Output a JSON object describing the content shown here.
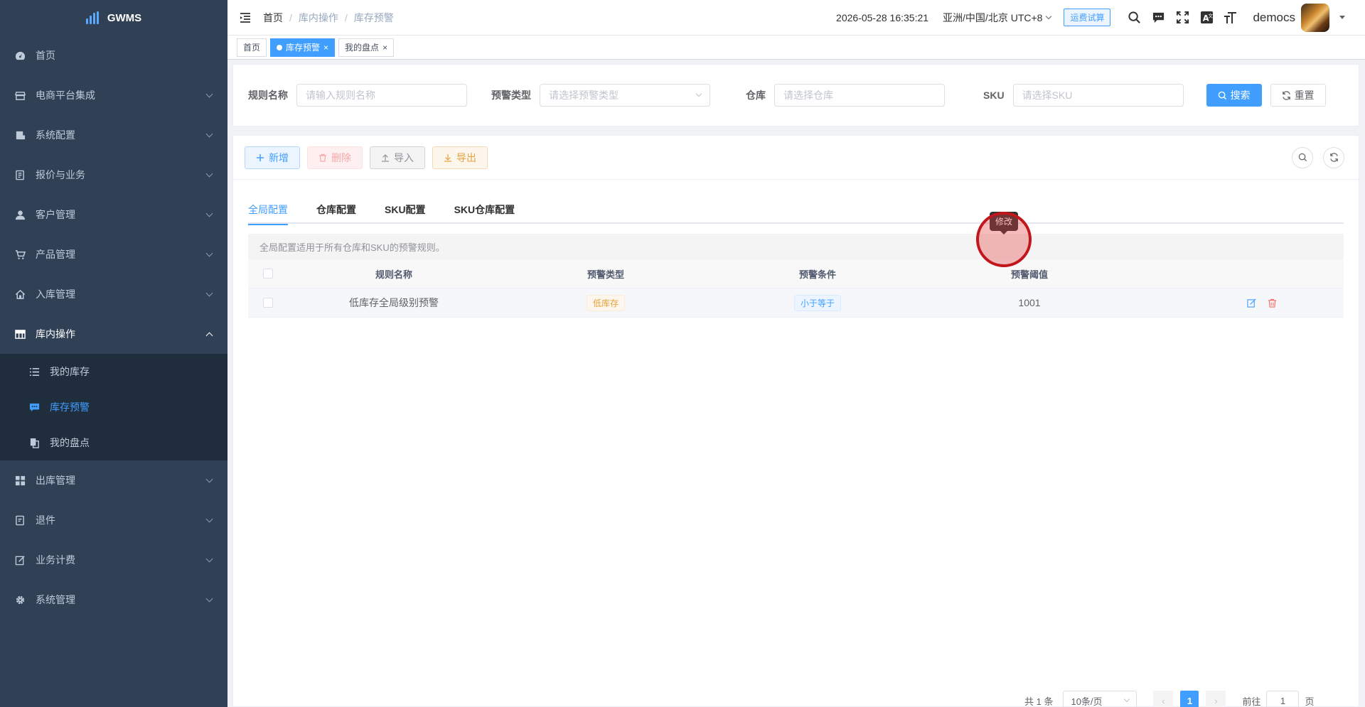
{
  "app": {
    "title": "GWMS"
  },
  "sidebar": {
    "items": [
      {
        "label": "首页",
        "icon": "dashboard-icon"
      },
      {
        "label": "电商平台集成",
        "icon": "store-icon"
      },
      {
        "label": "系统配置",
        "icon": "config-icon"
      },
      {
        "label": "报价与业务",
        "icon": "quote-icon"
      },
      {
        "label": "客户管理",
        "icon": "user-icon"
      },
      {
        "label": "产品管理",
        "icon": "cart-icon"
      },
      {
        "label": "入库管理",
        "icon": "home-icon"
      },
      {
        "label": "库内操作",
        "icon": "grid-icon"
      },
      {
        "label": "出库管理",
        "icon": "apps-icon"
      },
      {
        "label": "退件",
        "icon": "return-icon"
      },
      {
        "label": "业务计费",
        "icon": "edit-icon"
      },
      {
        "label": "系统管理",
        "icon": "gear-icon"
      }
    ],
    "submenu": [
      {
        "label": "我的库存",
        "icon": "list-icon"
      },
      {
        "label": "库存预警",
        "icon": "message-icon"
      },
      {
        "label": "我的盘点",
        "icon": "copy-icon"
      }
    ]
  },
  "header": {
    "breadcrumb": [
      "首页",
      "库内操作",
      "库存预警"
    ],
    "datetime": "2026-05-28 16:35:21",
    "timezone": "亚洲/中国/北京 UTC+8",
    "freight_badge": "运费试算",
    "username": "democs"
  },
  "tags": [
    {
      "label": "首页"
    },
    {
      "label": "库存预警"
    },
    {
      "label": "我的盘点"
    }
  ],
  "search": {
    "rule_name_label": "规则名称",
    "rule_name_placeholder": "请输入规则名称",
    "warn_type_label": "预警类型",
    "warn_type_placeholder": "请选择预警类型",
    "warehouse_label": "仓库",
    "warehouse_placeholder": "请选择仓库",
    "sku_label": "SKU",
    "sku_placeholder": "请选择SKU",
    "search_btn": "搜索",
    "reset_btn": "重置"
  },
  "toolbar": {
    "add": "新增",
    "delete": "删除",
    "import": "导入",
    "export": "导出"
  },
  "tabs": [
    "全局配置",
    "仓库配置",
    "SKU配置",
    "SKU仓库配置"
  ],
  "alert": "全局配置适用于所有仓库和SKU的预警规则。",
  "table": {
    "headers": [
      "规则名称",
      "预警类型",
      "预警条件",
      "预警阈值"
    ],
    "rows": [
      {
        "name": "低库存全局级别预警",
        "type": "低库存",
        "condition": "小于等于",
        "threshold": "1001"
      }
    ]
  },
  "tooltip": "修改",
  "pagination": {
    "total": "共 1 条",
    "page_size": "10条/页",
    "current": "1",
    "goto_label": "前往",
    "goto_value": "1",
    "page_suffix": "页"
  },
  "colors": {
    "primary": "#409eff",
    "sidebar_bg": "#304156",
    "highlight": "#c0161c"
  }
}
